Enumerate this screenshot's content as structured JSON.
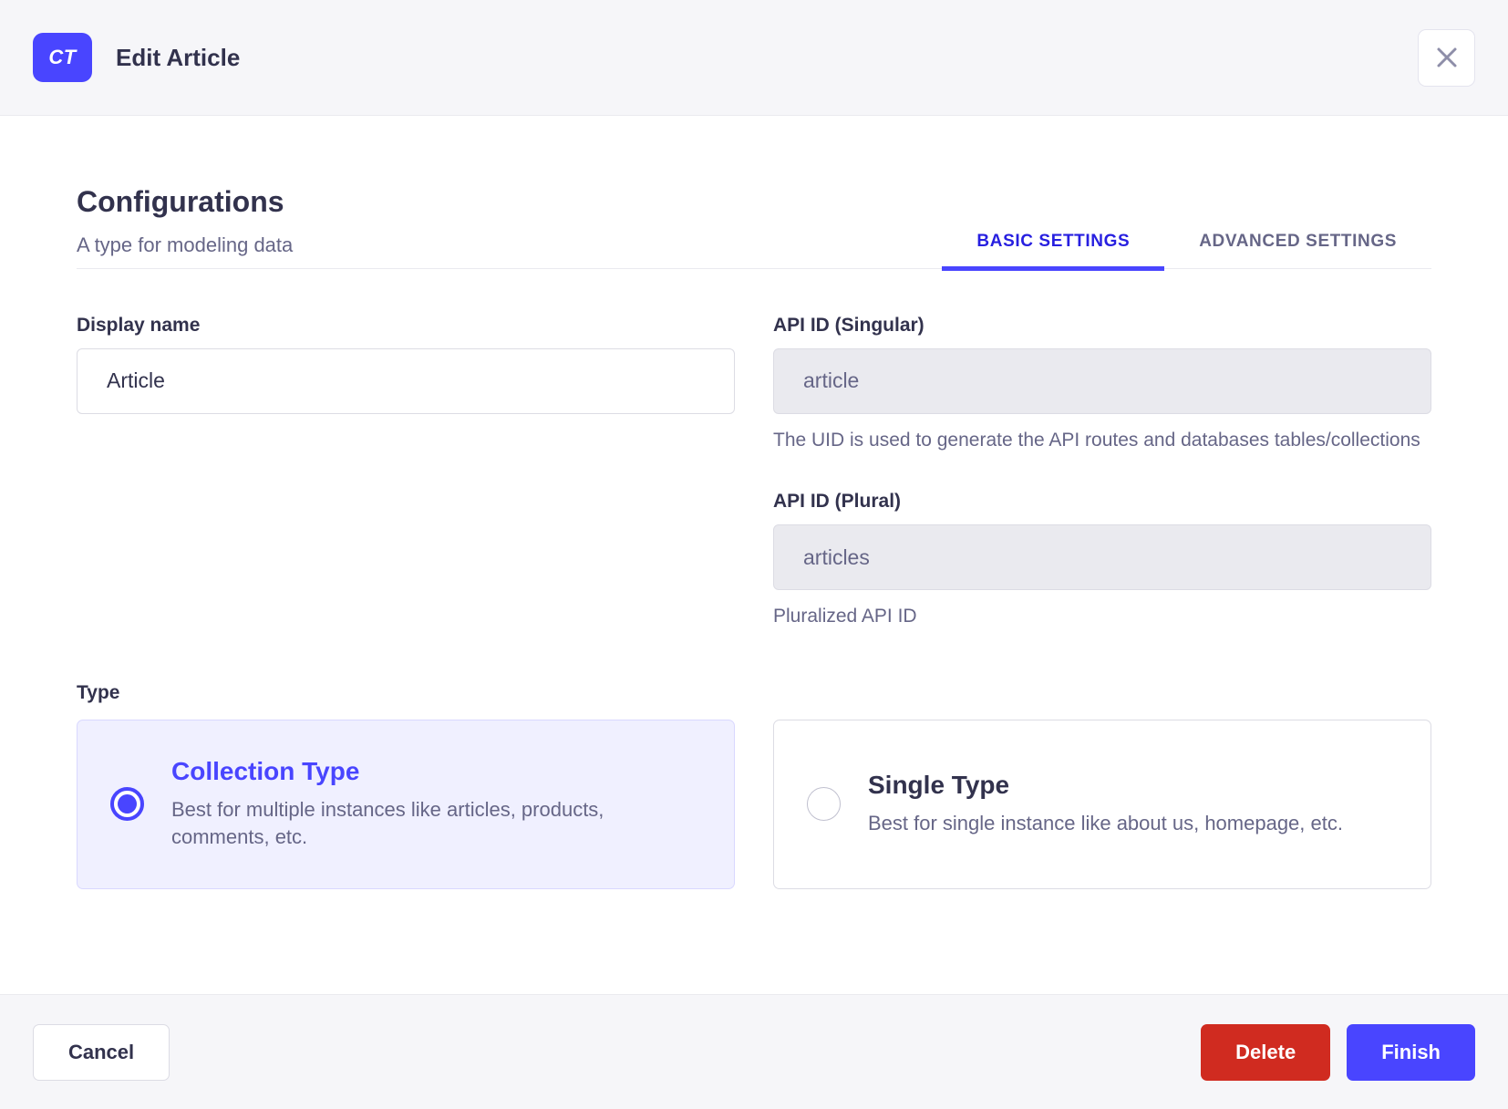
{
  "header": {
    "badge": "CT",
    "title": "Edit Article"
  },
  "intro": {
    "title": "Configurations",
    "subtitle": "A type for modeling data",
    "tabs": [
      {
        "label": "BASIC SETTINGS",
        "active": true
      },
      {
        "label": "ADVANCED SETTINGS",
        "active": false
      }
    ]
  },
  "form": {
    "display_name": {
      "label": "Display name",
      "value": "Article"
    },
    "api_id_singular": {
      "label": "API ID (Singular)",
      "value": "article",
      "hint": "The UID is used to generate the API routes and databases tables/collections"
    },
    "api_id_plural": {
      "label": "API ID (Plural)",
      "value": "articles",
      "hint": "Pluralized API ID"
    },
    "type": {
      "label": "Type",
      "options": [
        {
          "title": "Collection Type",
          "description": "Best for multiple instances like articles, products, comments, etc.",
          "selected": true
        },
        {
          "title": "Single Type",
          "description": "Best for single instance like about us, homepage, etc.",
          "selected": false
        }
      ]
    }
  },
  "footer": {
    "cancel_label": "Cancel",
    "delete_label": "Delete",
    "finish_label": "Finish"
  },
  "colors": {
    "primary": "#4945ff",
    "primary_tab_text": "#271fe0",
    "selected_card_bg": "#f0f0ff",
    "selected_card_border": "#d9d8ff",
    "danger": "#d02b20",
    "neutral_bg": "#f6f6f9",
    "border": "#dcdce4",
    "divider": "#eaeaef",
    "text": "#32324d",
    "muted_text": "#666687",
    "icon": "#8e8ea9"
  }
}
